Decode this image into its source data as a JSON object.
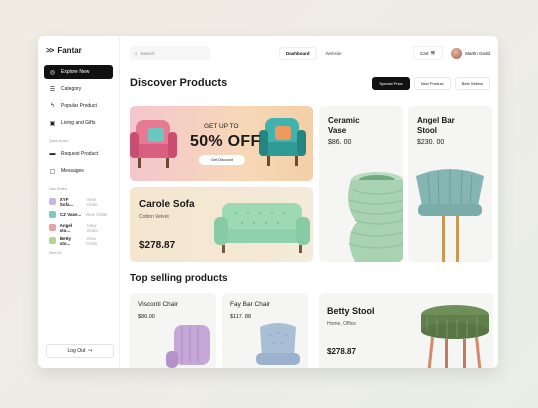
{
  "app": {
    "name": "Fantar"
  },
  "sidebar": {
    "items": [
      {
        "label": "Explore New",
        "icon": "compass-icon",
        "active": true
      },
      {
        "label": "Category",
        "icon": "list-icon"
      },
      {
        "label": "Popular Product",
        "icon": "bolt-icon"
      },
      {
        "label": "Living and Gifts",
        "icon": "gift-icon"
      }
    ],
    "quick_section": "Quick Action",
    "quick_items": [
      {
        "label": "Request Product",
        "icon": "bed-icon"
      },
      {
        "label": "Messages",
        "icon": "message-icon"
      }
    ],
    "orders_section": "Last Orders",
    "orders": [
      {
        "name": "XYF Sofa...",
        "view": "View Order",
        "color": "#c9b6e8"
      },
      {
        "name": "CZ Vase...",
        "view": "View Order",
        "color": "#7fc9c0"
      },
      {
        "name": "Angel sto...",
        "view": "View Order",
        "color": "#e7a0a6"
      },
      {
        "name": "Betty sto...",
        "view": "View Order",
        "color": "#b8d28a"
      }
    ],
    "see_all": "See All",
    "logout": "Log Out"
  },
  "topbar": {
    "search_placeholder": "Search",
    "tabs": [
      "Dashboard",
      "Website"
    ],
    "cart": "Cart",
    "user": "Martin Gedd"
  },
  "discover": {
    "title": "Discover Products",
    "filters": [
      "Special Price",
      "New Product",
      "Best Sellers"
    ]
  },
  "promo": {
    "upto": "GET UP TO",
    "off": "50% OFF",
    "button": "Get Discount"
  },
  "sofa": {
    "name": "Carole Sofa",
    "sub": "Cotton Velvet",
    "price": "$278.87"
  },
  "ceramic": {
    "name_line1": "Ceramic",
    "name_line2": "Vase",
    "price": "$86. 00"
  },
  "angel": {
    "name_line1": "Angel Bar",
    "name_line2": "Stool",
    "price": "$230. 00"
  },
  "top_selling": {
    "title": "Top selling products",
    "items": [
      {
        "name": "Visconti Chair",
        "price": "$86.00"
      },
      {
        "name": "Fay Bar Chair",
        "price": "$117. 88"
      },
      {
        "name": "Betty Stool",
        "sub": "Home, Office",
        "price": "$278.87"
      }
    ]
  },
  "colors": {
    "accent": "#111111",
    "mint": "#8fd1ae",
    "promo_pink": "#f4c6ce"
  }
}
